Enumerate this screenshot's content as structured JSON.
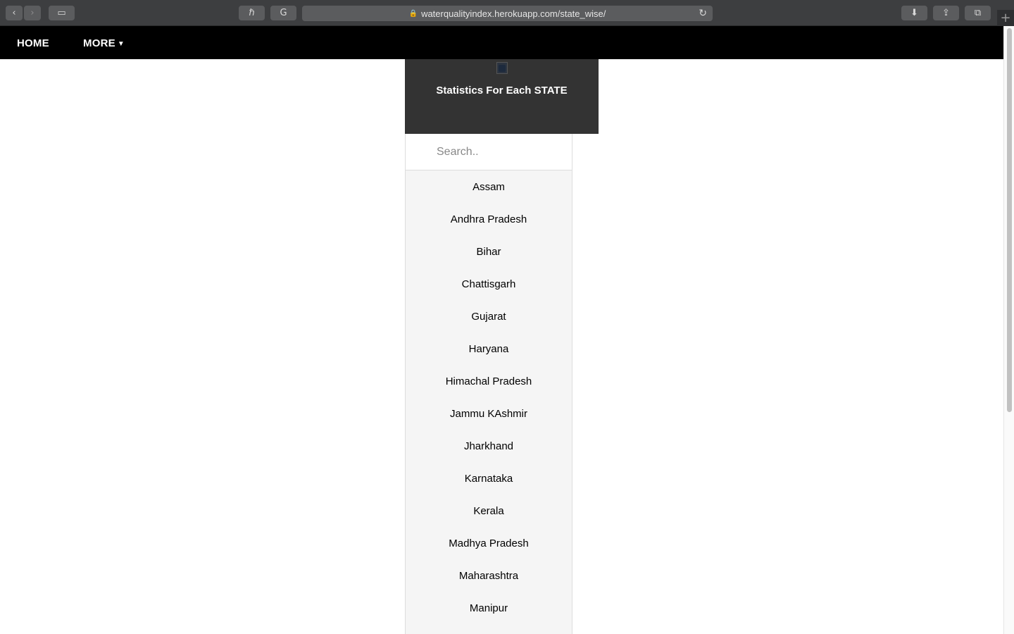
{
  "browser": {
    "url": "waterqualityindex.herokuapp.com/state_wise/",
    "buttons": {
      "back": "‹",
      "forward": "›",
      "sidebar": "▭",
      "ext1": "ℏ",
      "ext2": "G",
      "reload": "↻",
      "download": "⬇",
      "share": "⇪",
      "tabs": "⧉",
      "new_tab": "+"
    }
  },
  "navbar": {
    "home_label": "HOME",
    "more_label": "MORE"
  },
  "header": {
    "title": "Statistics For Each STATE"
  },
  "search": {
    "placeholder": "Search.."
  },
  "states": [
    "Assam",
    "Andhra Pradesh",
    "Bihar",
    "Chattisgarh",
    "Gujarat",
    "Haryana",
    "Himachal Pradesh",
    "Jammu KAshmir",
    "Jharkhand",
    "Karnataka",
    "Kerala",
    "Madhya Pradesh",
    "Maharashtra",
    "Manipur"
  ],
  "colors": {
    "navbar": "#000000",
    "header_bg": "#333333",
    "list_bg": "#f5f5f5"
  }
}
